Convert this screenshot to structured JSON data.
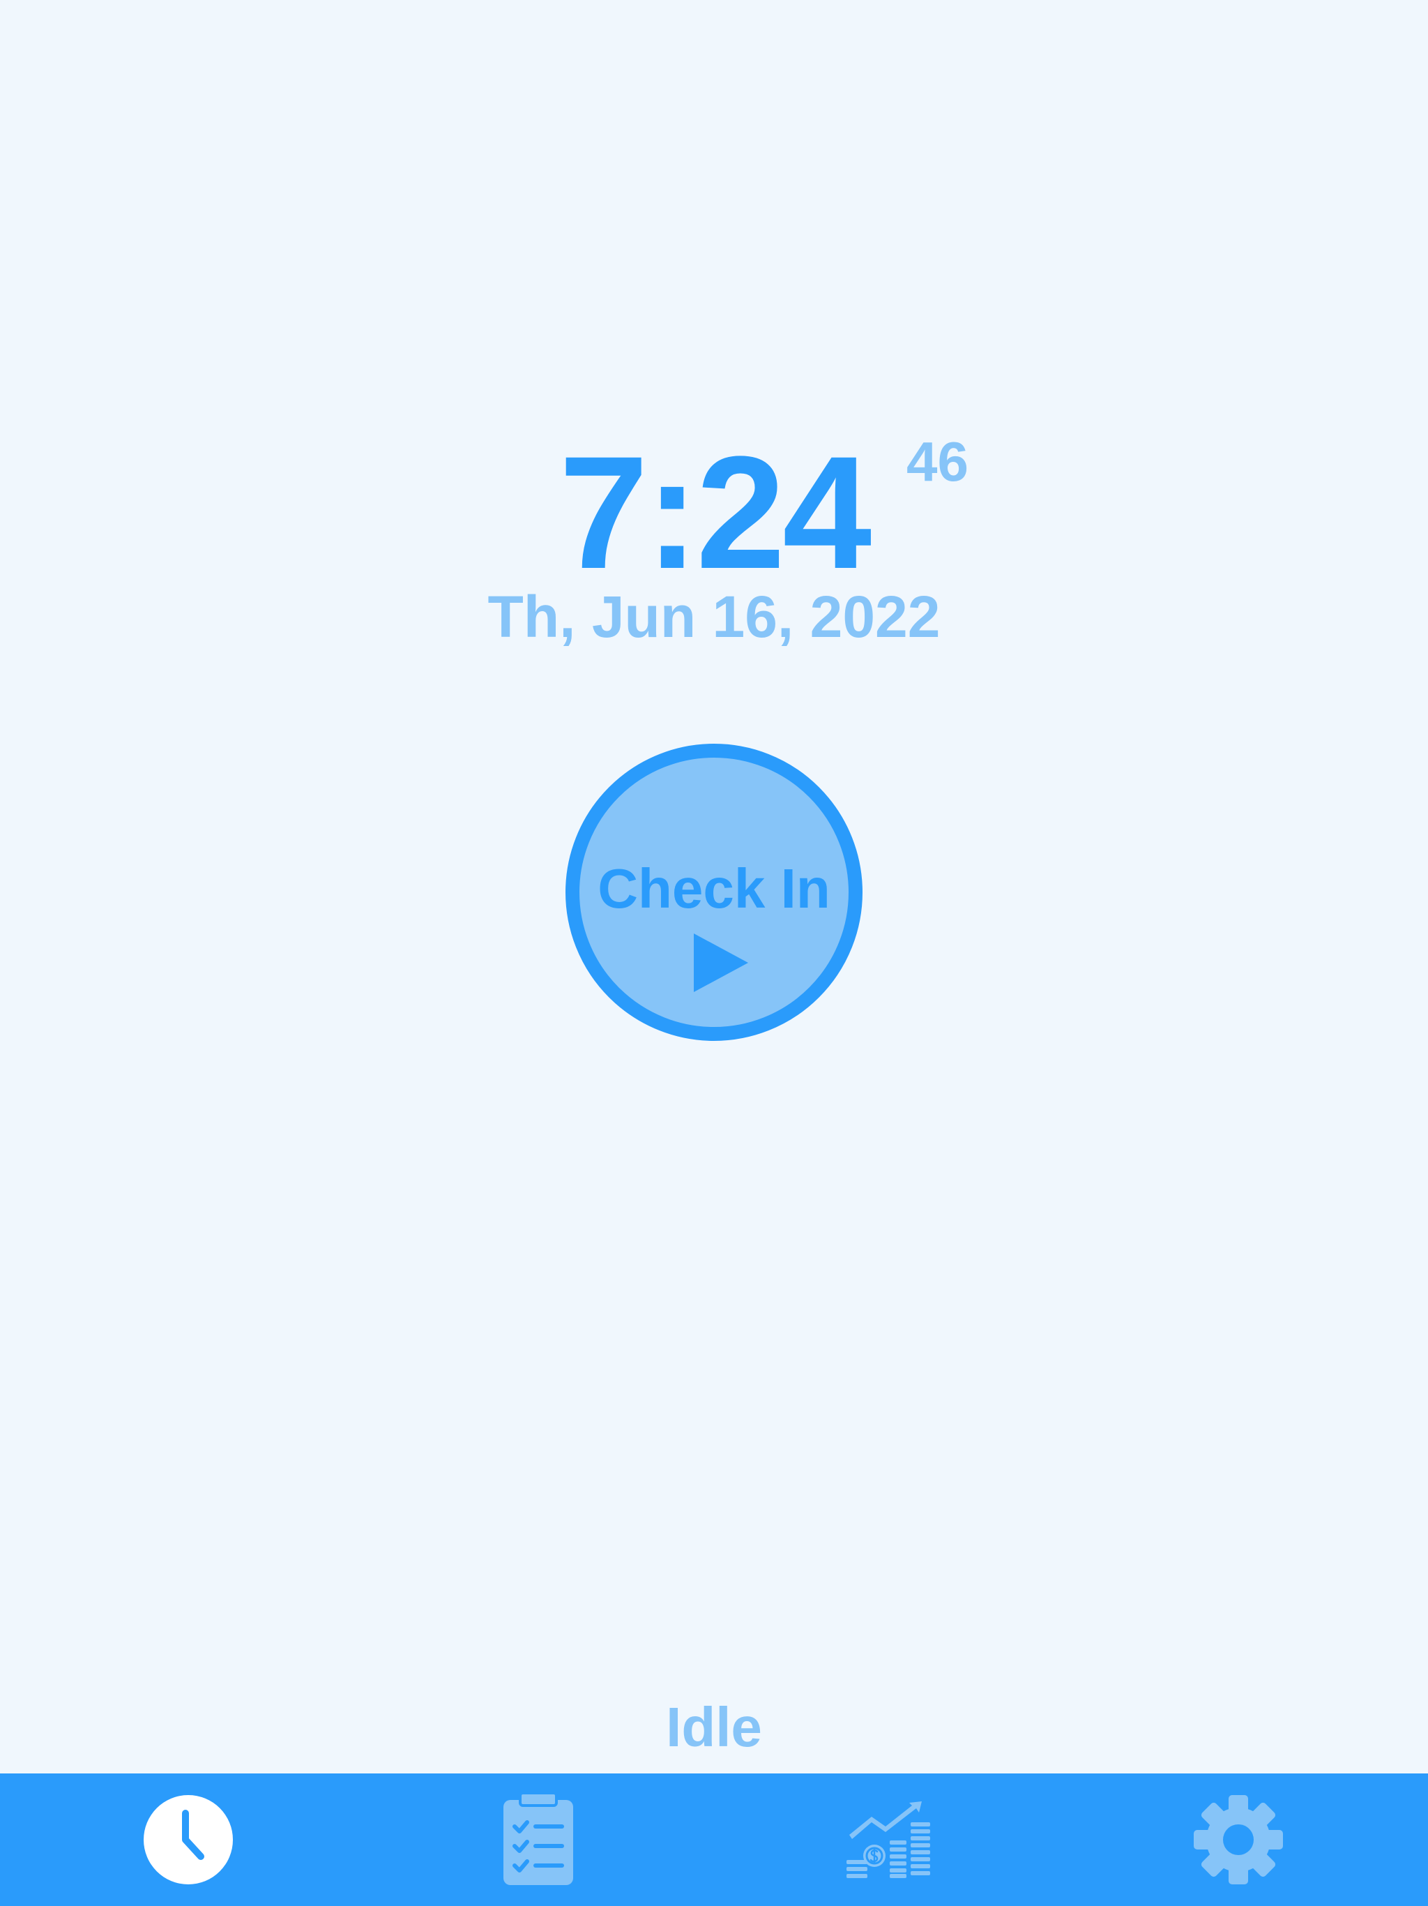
{
  "clock": {
    "time": "7:24",
    "seconds": "46",
    "date": "Th, Jun 16, 2022"
  },
  "checkin": {
    "label": "Check In",
    "icon": "play-icon"
  },
  "status": {
    "text": "Idle"
  },
  "tabs": [
    {
      "icon": "clock-icon",
      "active": true
    },
    {
      "icon": "clipboard-checklist-icon",
      "active": false
    },
    {
      "icon": "earnings-chart-icon",
      "active": false
    },
    {
      "icon": "gear-icon",
      "active": false
    }
  ],
  "colors": {
    "background": "#f0f7fd",
    "accent": "#2a9bfb",
    "accent_light": "#86c4f8",
    "active_icon": "#ffffff"
  }
}
